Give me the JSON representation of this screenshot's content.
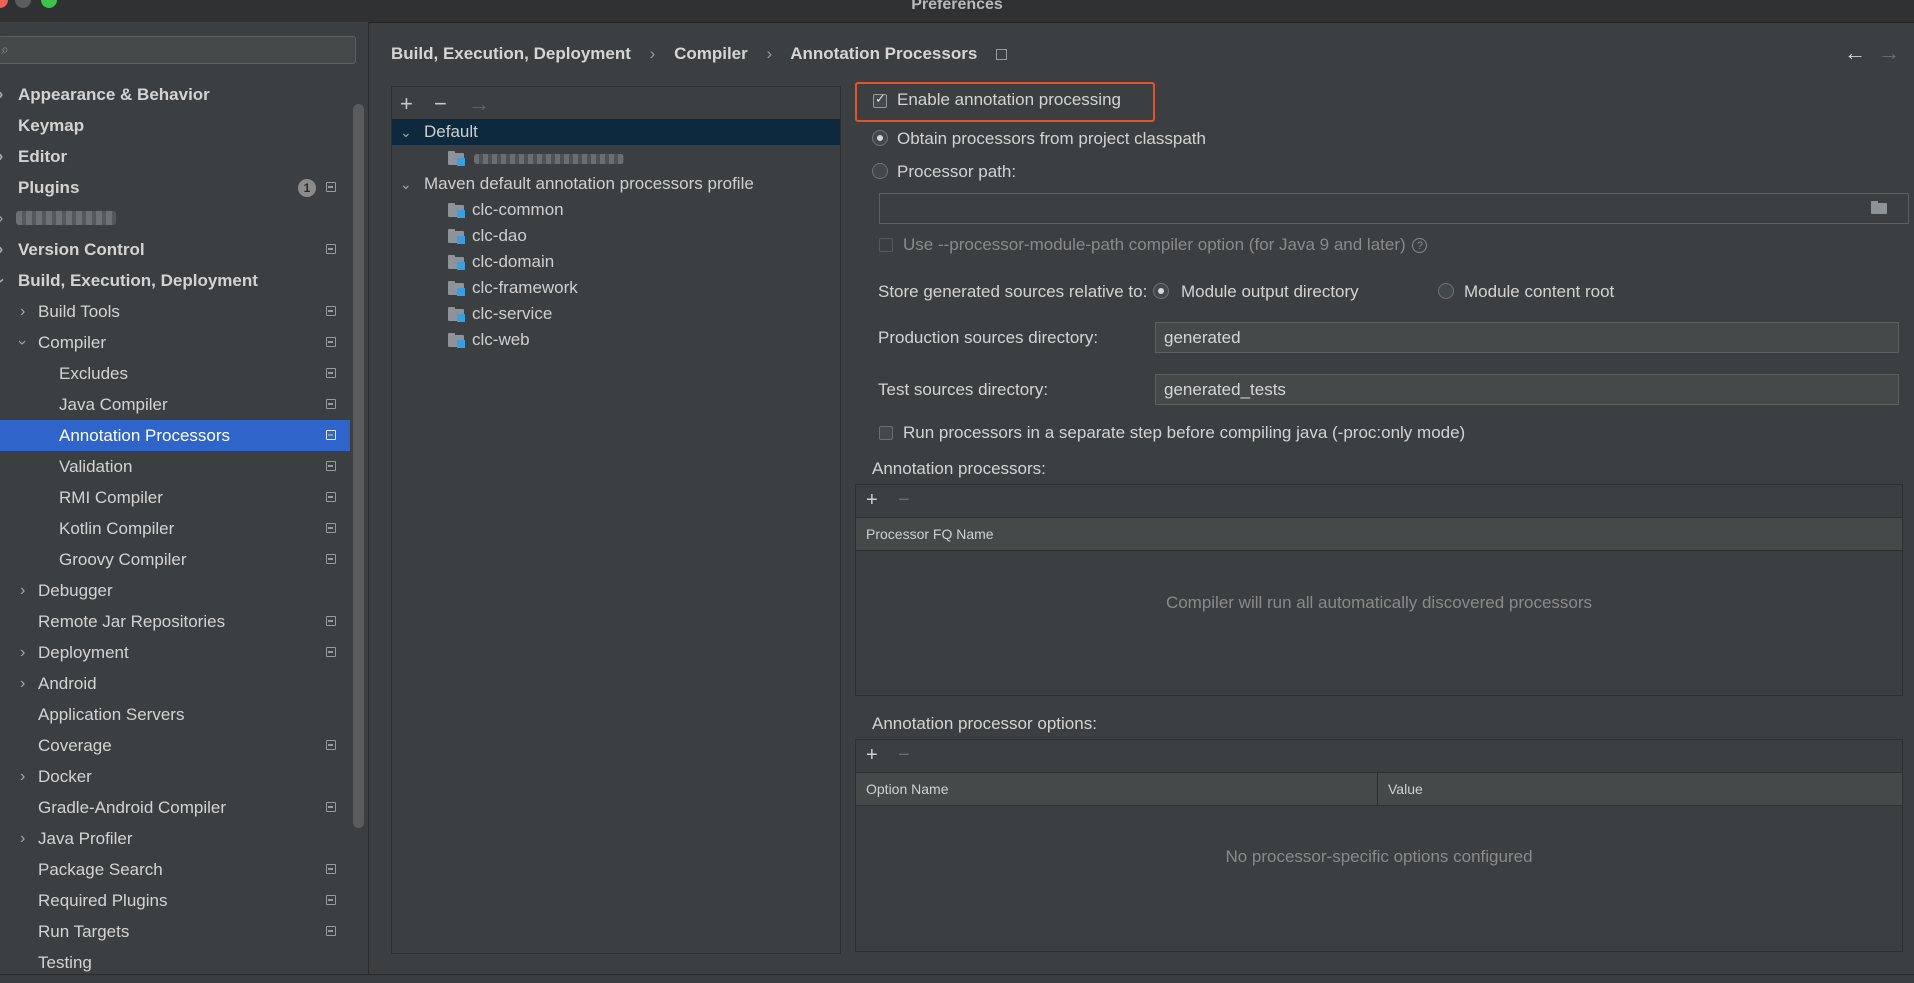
{
  "window": {
    "title": "Preferences"
  },
  "colors": {
    "selection": "#2f65ca",
    "highlight_border": "#e5532b",
    "background": "#3c3f41"
  },
  "search": {
    "value": "",
    "placeholder": ""
  },
  "sidebar": {
    "items": [
      {
        "label": "Appearance & Behavior",
        "expandable": true
      },
      {
        "label": "Keymap"
      },
      {
        "label": "Editor",
        "expandable": true
      },
      {
        "label": "Plugins",
        "badge": "1"
      },
      {
        "label": "",
        "redacted": true
      },
      {
        "label": "Version Control",
        "expandable": true
      },
      {
        "label": "Build, Execution, Deployment",
        "expanded": true
      },
      {
        "label": "Build Tools"
      },
      {
        "label": "Compiler"
      },
      {
        "label": "Excludes"
      },
      {
        "label": "Java Compiler"
      },
      {
        "label": "Annotation Processors",
        "selected": true
      },
      {
        "label": "Validation"
      },
      {
        "label": "RMI Compiler"
      },
      {
        "label": "Kotlin Compiler"
      },
      {
        "label": "Groovy Compiler"
      },
      {
        "label": "Debugger"
      },
      {
        "label": "Remote Jar Repositories"
      },
      {
        "label": "Deployment"
      },
      {
        "label": "Android"
      },
      {
        "label": "Application Servers"
      },
      {
        "label": "Coverage"
      },
      {
        "label": "Docker"
      },
      {
        "label": "Gradle-Android Compiler"
      },
      {
        "label": "Java Profiler"
      },
      {
        "label": "Package Search"
      },
      {
        "label": "Required Plugins"
      },
      {
        "label": "Run Targets"
      },
      {
        "label": "Testing"
      }
    ]
  },
  "breadcrumb": {
    "items": [
      "Build, Execution, Deployment",
      "Compiler",
      "Annotation Processors"
    ],
    "separator": "›"
  },
  "nav": {
    "back": "←",
    "forward": "→"
  },
  "profiles": {
    "toolbar": {
      "add": "+",
      "remove": "−",
      "move": "→"
    },
    "rows": [
      {
        "label": "Default",
        "chevron": "⌄",
        "selected": true
      },
      {
        "label": "",
        "redacted": true
      },
      {
        "label": "Maven default annotation processors profile",
        "chevron": "⌄"
      },
      {
        "label": "clc-common"
      },
      {
        "label": "clc-dao"
      },
      {
        "label": "clc-domain"
      },
      {
        "label": "clc-framework"
      },
      {
        "label": "clc-service"
      },
      {
        "label": "clc-web"
      }
    ]
  },
  "options": {
    "enable_label": "Enable annotation processing",
    "enable_checked": true,
    "obtain_label": "Obtain processors from project classpath",
    "processor_path_label": "Processor path:",
    "processor_path_value": "",
    "module_path_label": "Use --processor-module-path compiler option (for Java 9 and later)",
    "help": "?",
    "store_label": "Store generated sources relative to:",
    "module_output_label": "Module output directory",
    "module_content_label": "Module content root",
    "production_label": "Production sources directory:",
    "production_value": "generated",
    "test_label": "Test sources directory:",
    "test_value": "generated_tests",
    "separate_step_label": "Run processors in a separate step before compiling java (-proc:only mode)"
  },
  "processors_table": {
    "title": "Annotation processors:",
    "add": "+",
    "remove": "−",
    "columns": [
      "Processor FQ Name"
    ],
    "empty_text": "Compiler will run all automatically discovered processors"
  },
  "options_table": {
    "title": "Annotation processor options:",
    "add": "+",
    "remove": "−",
    "columns": [
      "Option Name",
      "Value"
    ],
    "empty_text": "No processor-specific options configured"
  }
}
